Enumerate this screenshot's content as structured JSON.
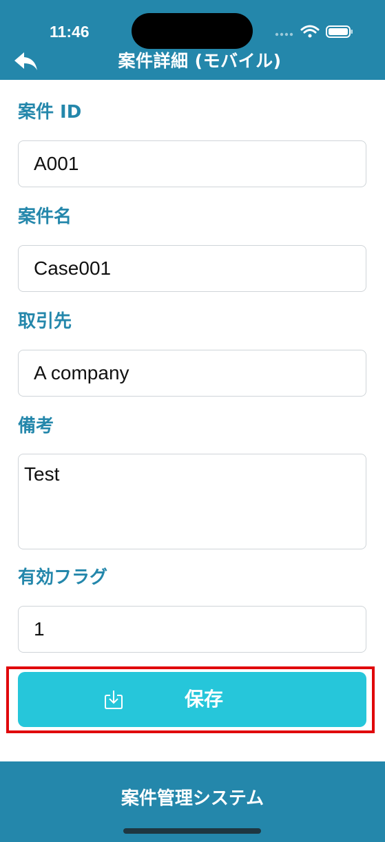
{
  "status_bar": {
    "time": "11:46",
    "icons": [
      "cellular-dots-icon",
      "wifi-icon",
      "battery-icon"
    ]
  },
  "nav": {
    "back_icon": "back-arrow-icon",
    "title": "案件詳細 (モバイル)"
  },
  "form": {
    "case_id": {
      "label": "案件 ID",
      "value": "A001"
    },
    "case_name": {
      "label": "案件名",
      "value": "Case001"
    },
    "client": {
      "label": "取引先",
      "value": "A company"
    },
    "remarks": {
      "label": "備考",
      "value": "Test"
    },
    "active_flag": {
      "label": "有効フラグ",
      "value": "1"
    }
  },
  "save_button": {
    "label": "保存",
    "icon": "save-download-icon",
    "highlighted": true
  },
  "footer": {
    "title": "案件管理システム"
  },
  "colors": {
    "header_bg": "#2487ab",
    "label_color": "#2487ab",
    "button_bg": "#26c6da",
    "highlight_border": "#e0060b"
  }
}
